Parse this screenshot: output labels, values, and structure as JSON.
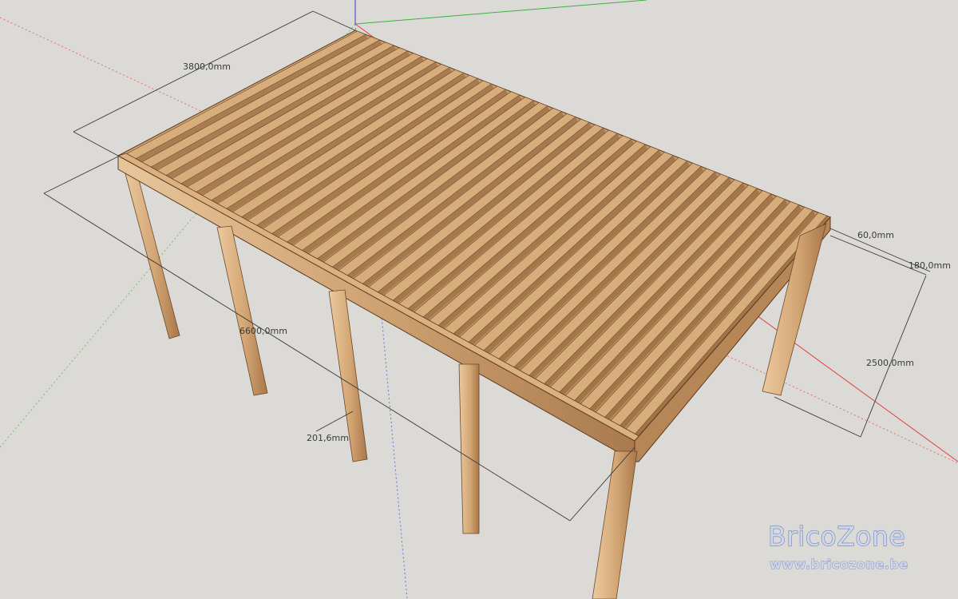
{
  "dimensions": {
    "width_top": "3800,0mm",
    "length": "6600,0mm",
    "joist_width": "60,0mm",
    "joist_height": "180,0mm",
    "post_height": "2500,0mm",
    "post_spacing": "201,6mm"
  },
  "watermark": {
    "brand": "BricoZone",
    "url": "www.bricozone.be"
  },
  "colors": {
    "background": "#dcdad6",
    "wood": "#c89a6a",
    "wood_dark": "#9b6f45",
    "axis_red": "#e04040",
    "axis_green": "#3cb040",
    "axis_blue": "#3a3ad0"
  }
}
